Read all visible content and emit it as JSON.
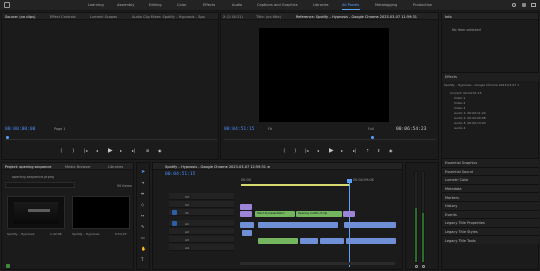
{
  "workspaces": [
    "Learning",
    "Assembly",
    "Editing",
    "Color",
    "Effects",
    "Audio",
    "Captions and Graphics",
    "Libraries",
    "All Panels",
    "Metalogging",
    "Production"
  ],
  "workspace_active": "All Panels",
  "source_tabs": [
    "Source: (no clips)",
    "Effect Controls",
    "Lumetri Scopes",
    "Audio Clip Mixer: Spotify – Hypnosis - Spo",
    "X (1:18:31)",
    "Title: (no title)"
  ],
  "program_tab": "Reference: Spotify – Hypnosis - Google Chrome 2023-03-07 11:59:31",
  "source_timecode": "00:00:00:00",
  "source_page": "Page 1",
  "program_timecode_left": "00:04:51:15",
  "program_fit": "Fit",
  "program_full": "Full",
  "program_timecode_right": "00:06:54:23",
  "info_tab": "Info",
  "info_no_item": "No item selected",
  "effects_label": "Effects",
  "info_detail_title": "Spotify – Hypnosis - Google Chrome 2023-03-07 1",
  "info_detail_lines": [
    "Current: 00:04:51:15",
    "Video 1",
    "Video 2",
    "Video 3",
    "Audio 1: 00:00:11:24",
    "Audio 2: 00:00:00:08",
    "Audio 3: 00:00:13:03",
    "Audio 4"
  ],
  "right_panels": [
    "Essential Graphics",
    "Essential Sound",
    "Lumetri Color",
    "Metadata",
    "Markers",
    "History",
    "Events",
    "Legacy Title Properties",
    "Legacy Title Styles",
    "Legacy Title Tools"
  ],
  "project_tabs": [
    "Project: opening sequence",
    "Media Browser",
    "Libraries"
  ],
  "project_file": "opening sequence.prproj",
  "project_item_count": "50 items",
  "project_thumbs": [
    {
      "name": "Spotify – Hypnosis",
      "dur": "1:42:08"
    },
    {
      "name": "Spotify – Hypnosis",
      "dur": "6:54:23"
    }
  ],
  "timeline_tab": "Spotify – Hypnosis - Google Chrome 2023-03-07 12:59:31 ≡",
  "timeline_timecode": "00:04:51:15",
  "ruler_labels": [
    "00:00",
    "00:04:59:08"
  ],
  "tracks": [
    "V3",
    "V2",
    "V1",
    "A1",
    "A2",
    "A3",
    "A4"
  ],
  "clips_v2": [
    "Hand Dj presentation",
    "Opening credits of clip"
  ],
  "icons": {
    "play": "play-icon",
    "select": "selection-tool-icon"
  },
  "colors": {
    "accent": "#5aa0ff",
    "timecode": "#4b8dff",
    "clip_video": "#9d84d6",
    "clip_audio": "#6f8fd6",
    "clip_green": "#73b65e"
  }
}
